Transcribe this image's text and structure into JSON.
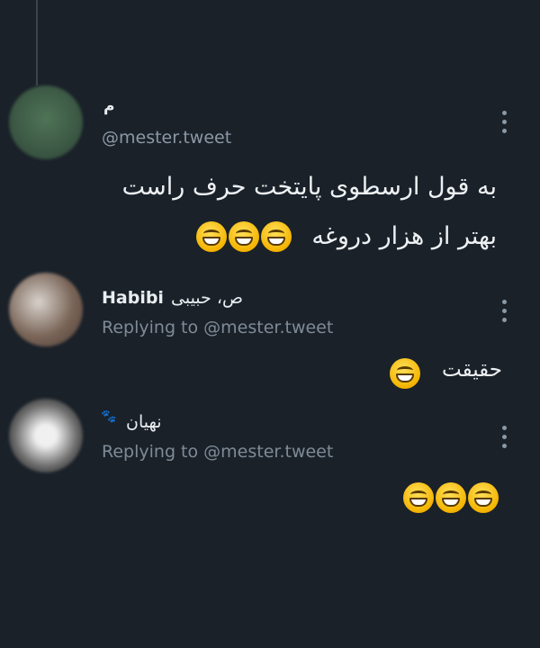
{
  "tweets": [
    {
      "name": "م",
      "handle": "@mester.tweet",
      "text_line1": "به قول ارسطوی پایتخت حرف راست",
      "text_line2": "بهتر از هزار دروغه",
      "emoji_count": 3,
      "emoji_icon": "laughing-face-icon",
      "avatar_color": "#3c5a45"
    },
    {
      "name_latin": "Habibi",
      "name_farsi": "ص، حبیبی",
      "replying_to": "Replying to @mester.tweet",
      "text": "حقیقت",
      "emoji_count": 1,
      "emoji_icon": "laughing-face-icon",
      "avatar_color": "#8a7f78"
    },
    {
      "name": "نهیان",
      "name_icon": "paw-prints-icon",
      "replying_to": "Replying to @mester.tweet",
      "emoji_count": 3,
      "emoji_icon": "laughing-face-icon",
      "avatar_color": "#cfcfcf"
    }
  ],
  "colors": {
    "background": "#1a2129",
    "secondary_text": "#8b98a5",
    "primary_text": "#e9edf0"
  }
}
